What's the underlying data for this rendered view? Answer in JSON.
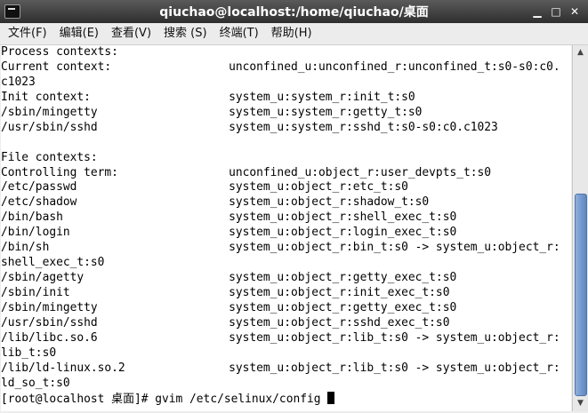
{
  "window": {
    "title": "qiuchao@localhost:/home/qiuchao/桌面",
    "minimize_glyph": "▁",
    "maximize_glyph": "□",
    "close_glyph": "✕"
  },
  "menu": [
    "文件(F)",
    "编辑(E)",
    "查看(V)",
    "搜索 (S)",
    "终端(T)",
    "帮助(H)"
  ],
  "terminal": {
    "lines": [
      "Process contexts:",
      "Current context:                 unconfined_u:unconfined_r:unconfined_t:s0-s0:c0.",
      "c1023",
      "Init context:                    system_u:system_r:init_t:s0",
      "/sbin/mingetty                   system_u:system_r:getty_t:s0",
      "/usr/sbin/sshd                   system_u:system_r:sshd_t:s0-s0:c0.c1023",
      "",
      "File contexts:",
      "Controlling term:                unconfined_u:object_r:user_devpts_t:s0",
      "/etc/passwd                      system_u:object_r:etc_t:s0",
      "/etc/shadow                      system_u:object_r:shadow_t:s0",
      "/bin/bash                        system_u:object_r:shell_exec_t:s0",
      "/bin/login                       system_u:object_r:login_exec_t:s0",
      "/bin/sh                          system_u:object_r:bin_t:s0 -> system_u:object_r:",
      "shell_exec_t:s0",
      "/sbin/agetty                     system_u:object_r:getty_exec_t:s0",
      "/sbin/init                       system_u:object_r:init_exec_t:s0",
      "/sbin/mingetty                   system_u:object_r:getty_exec_t:s0",
      "/usr/sbin/sshd                   system_u:object_r:sshd_exec_t:s0",
      "/lib/libc.so.6                   system_u:object_r:lib_t:s0 -> system_u:object_r:",
      "lib_t:s0",
      "/lib/ld-linux.so.2               system_u:object_r:lib_t:s0 -> system_u:object_r:",
      "ld_so_t:s0"
    ],
    "prompt": "[root@localhost 桌面]# gvim /etc/selinux/config "
  }
}
